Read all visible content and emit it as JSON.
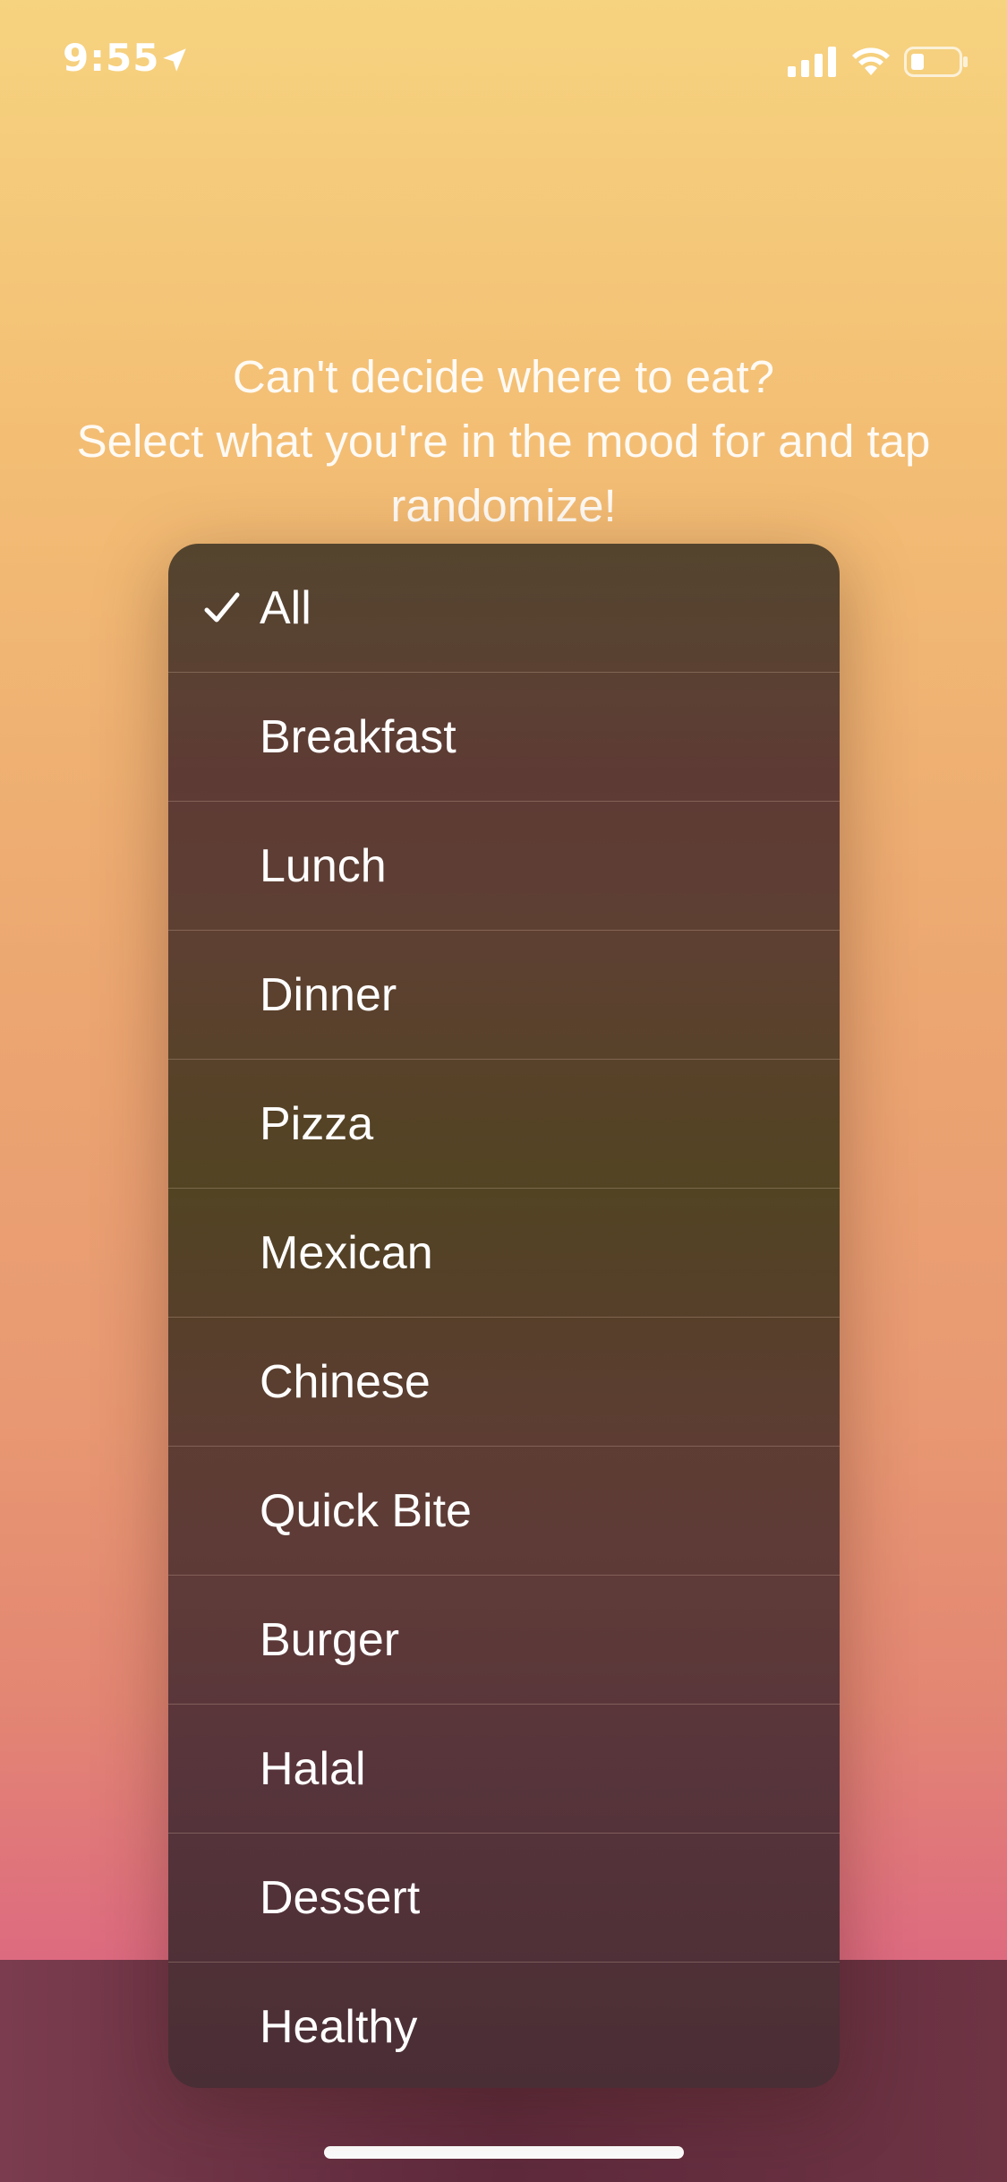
{
  "status_bar": {
    "time": "9:55",
    "icons": [
      "location-arrow-icon",
      "cellular-signal-icon",
      "wifi-icon",
      "battery-icon"
    ]
  },
  "headline": {
    "line1": "Can't decide where to eat?",
    "line2": "Select what you're in the mood for and tap",
    "line3": "randomize!"
  },
  "menu": {
    "selected": "All",
    "items": [
      {
        "label": "All",
        "checked": true
      },
      {
        "label": "Breakfast",
        "checked": false
      },
      {
        "label": "Lunch",
        "checked": false
      },
      {
        "label": "Dinner",
        "checked": false
      },
      {
        "label": "Pizza",
        "checked": false
      },
      {
        "label": "Mexican",
        "checked": false
      },
      {
        "label": "Chinese",
        "checked": false
      },
      {
        "label": "Quick Bite",
        "checked": false
      },
      {
        "label": "Burger",
        "checked": false
      },
      {
        "label": "Halal",
        "checked": false
      },
      {
        "label": "Dessert",
        "checked": false
      },
      {
        "label": "Healthy",
        "checked": false
      }
    ]
  },
  "colors": {
    "background_top": "#f6d37f",
    "background_bottom": "#d65d80",
    "menu_background": "#5a4030",
    "text": "#ffffff"
  }
}
